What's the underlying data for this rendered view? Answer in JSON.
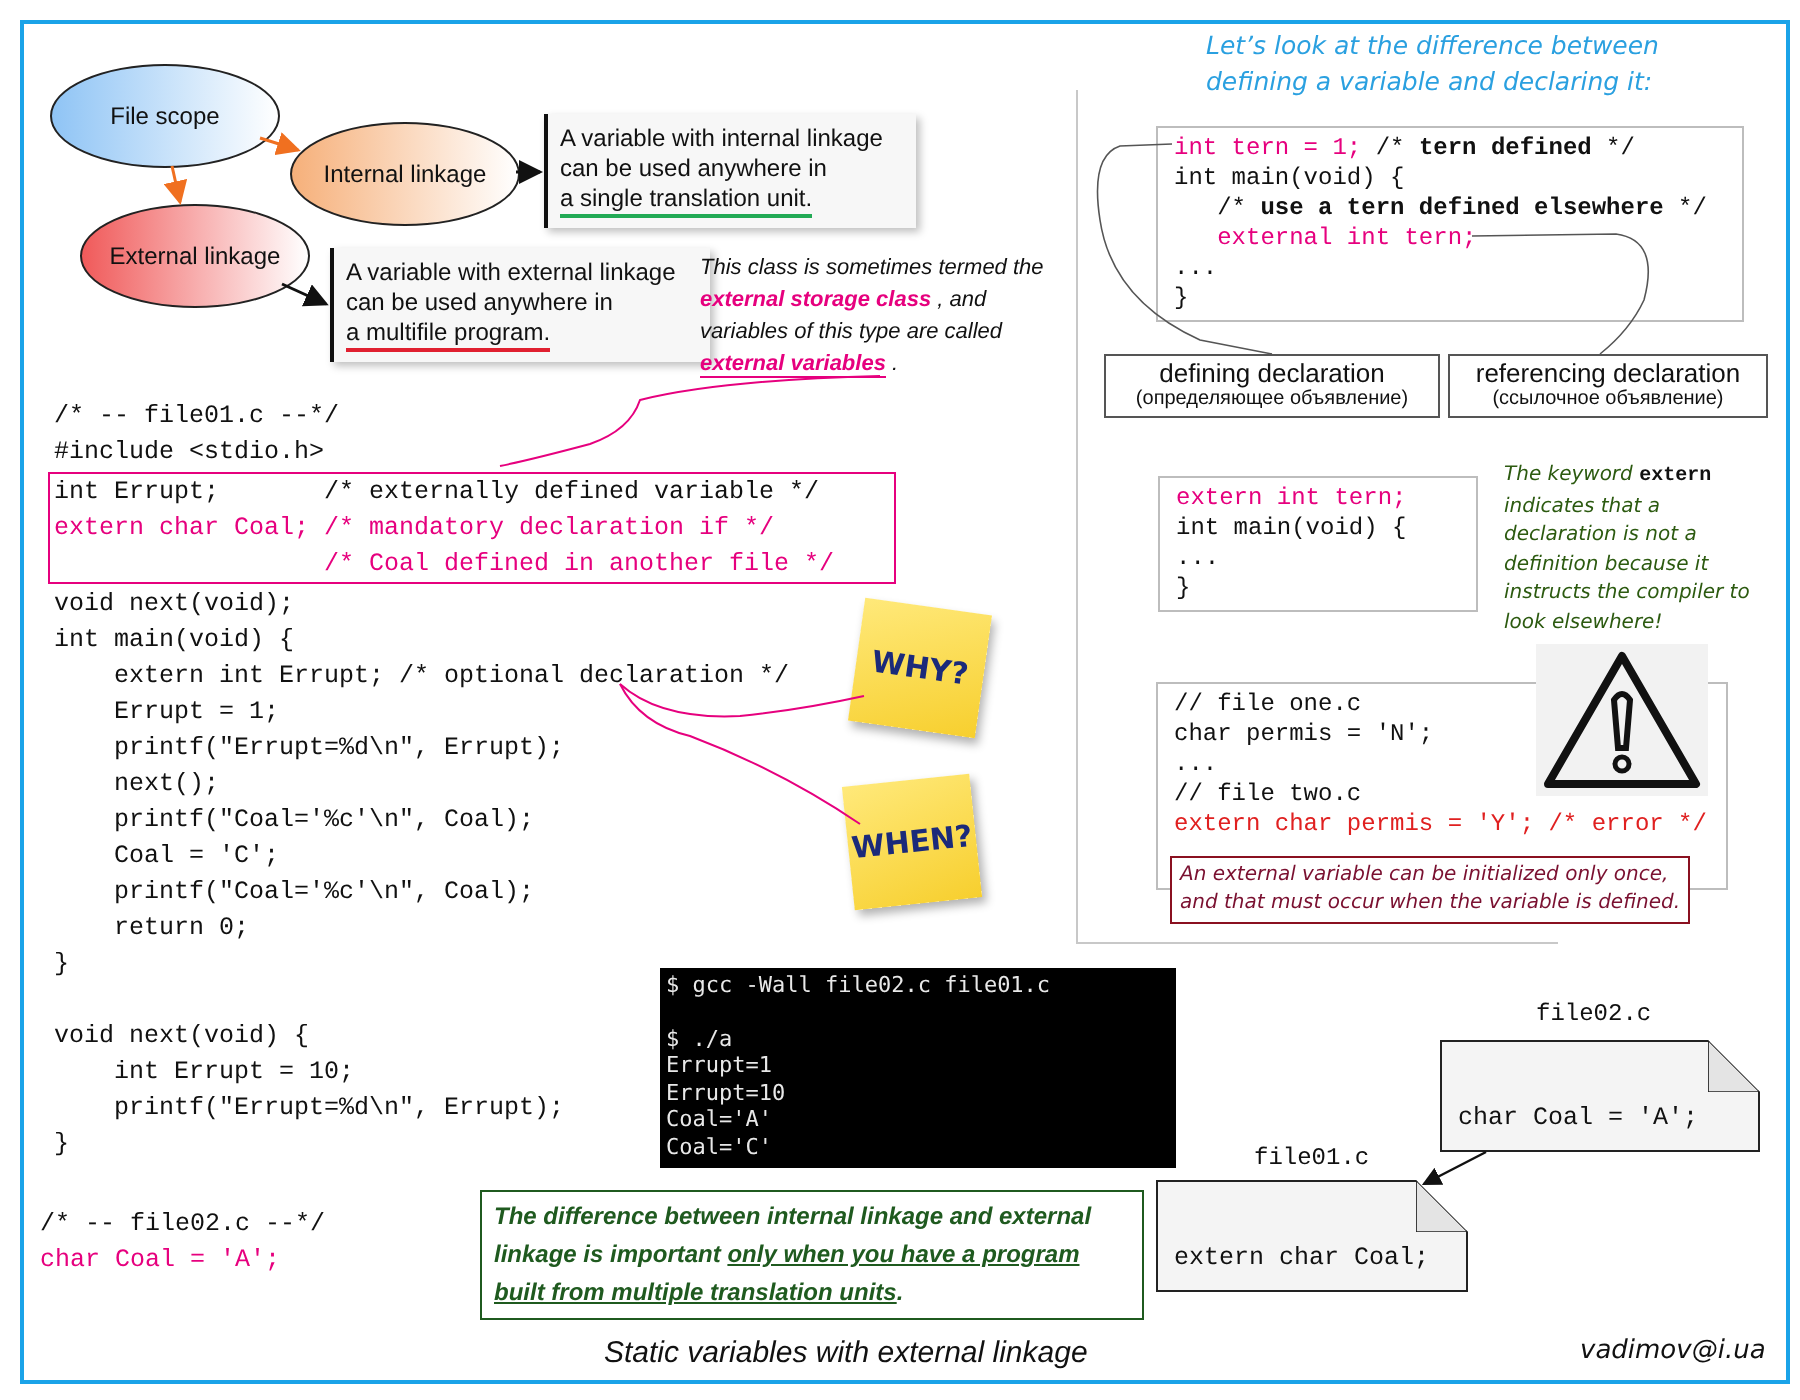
{
  "ellipses": [
    {
      "label": "File scope",
      "color": "#8fc4f5"
    },
    {
      "label": "Internal linkage",
      "color": "#f6b07a"
    },
    {
      "label": "External linkage",
      "color": "#f05a5a"
    }
  ],
  "notes": [
    {
      "lines": [
        "A variable with internal linkage",
        "can be used anywhere in",
        "a single translation unit."
      ],
      "color": "#22aa55"
    },
    {
      "lines": [
        "A variable with external linkage",
        "can be used anywhere in",
        "a multifile program."
      ],
      "color": "#e02030"
    }
  ],
  "side_note": "This class is sometimes termed the **external storage class** , and variables of this type are called **external variables** .",
  "file01_code": [
    {
      "boxed": false,
      "lines": [
        {
          "text": "/* -- file01.c --*/",
          "kind": "plain"
        },
        {
          "text": "#include <stdio.h>",
          "kind": "plain"
        }
      ]
    },
    {
      "boxed": true,
      "lines": [
        {
          "text": "int Errupt;       /* externally defined variable */",
          "kind": "plain"
        },
        {
          "text": "extern char Coal; /* mandatory declaration if */",
          "kind": "pink"
        },
        {
          "text": "                  /* Coal defined in another file */",
          "kind": "pink"
        }
      ]
    },
    {
      "boxed": false,
      "lines": [
        {
          "text": "void next(void);",
          "kind": "plain"
        },
        {
          "text": "int main(void) {",
          "kind": "plain"
        },
        {
          "text": "    extern int Errupt; /* optional declaration */",
          "kind": "plain"
        },
        {
          "text": "    Errupt = 1;",
          "kind": "plain"
        },
        {
          "text": "    printf(\"Errupt=%d\\n\", Errupt);",
          "kind": "plain"
        },
        {
          "text": "    next();",
          "kind": "plain"
        },
        {
          "text": "    printf(\"Coal='%c'\\n\", Coal);",
          "kind": "plain"
        },
        {
          "text": "    Coal = 'C';",
          "kind": "plain"
        },
        {
          "text": "    printf(\"Coal='%c'\\n\", Coal);",
          "kind": "plain"
        },
        {
          "text": "    return 0;",
          "kind": "plain"
        },
        {
          "text": "}",
          "kind": "plain"
        },
        {
          "text": "void next(void) {",
          "kind": "plain",
          "gap_before": true
        },
        {
          "text": "    int Errupt = 10;",
          "kind": "plain"
        },
        {
          "text": "    printf(\"Errupt=%d\\n\", Errupt);",
          "kind": "plain"
        },
        {
          "text": "}",
          "kind": "plain"
        }
      ]
    }
  ],
  "stickers": [
    {
      "label": "WHY?"
    },
    {
      "label": "WHEN?"
    }
  ],
  "terminal": [
    "$ gcc -Wall file02.c file01.c",
    "$ ./a",
    "Errupt=1",
    "Errupt=10",
    "Coal='A'",
    "Coal='C'"
  ],
  "file02_code": [
    {
      "text": "/* -- file02.c --*/",
      "kind": "plain"
    },
    {
      "text": "char Coal = 'A';",
      "kind": "pink"
    }
  ],
  "conclusion": [
    {
      "text": "The difference between internal linkage and external linkage is important ",
      "underlined": false
    },
    {
      "text": "only when you have a program built from multiple translation units",
      "underlined": true
    },
    {
      "text": ".",
      "underlined": false
    }
  ],
  "caption": "Static variables with external linkage",
  "author": "vadimov@i.ua",
  "right_panel": {
    "heading": [
      "Let’s look at the difference between",
      "defining a variable and declaring it:"
    ],
    "code_1": [
      [
        {
          "text": "int tern = 1; ",
          "kind": "pink"
        },
        {
          "text": "/* ",
          "kind": "plain"
        },
        {
          "text": "tern defined",
          "kind": "bold"
        },
        {
          "text": " */",
          "kind": "plain"
        }
      ],
      [
        {
          "text": "int main(void) {",
          "kind": "plain"
        }
      ],
      [
        {
          "text": "   /* ",
          "kind": "plain"
        },
        {
          "text": "use a tern defined elsewhere",
          "kind": "bold"
        },
        {
          "text": " */",
          "kind": "plain"
        }
      ],
      [
        {
          "text": "   external int tern;",
          "kind": "pink"
        }
      ],
      [
        {
          "text": "...",
          "kind": "plain"
        }
      ],
      [
        {
          "text": "}",
          "kind": "plain"
        }
      ]
    ],
    "labels": [
      {
        "title": "defining declaration",
        "subtitle": "(определяющее объявление)"
      },
      {
        "title": "referencing declaration",
        "subtitle": "(ссылочное объявление)"
      }
    ],
    "code_2": [
      [
        {
          "text": "extern int tern;",
          "kind": "pink"
        }
      ],
      [
        {
          "text": "int main(void) {",
          "kind": "plain"
        }
      ],
      [
        {
          "text": "...",
          "kind": "plain"
        }
      ],
      [
        {
          "text": "}",
          "kind": "plain"
        }
      ]
    ],
    "keyword_note": "The keyword **extern** indicates that a declaration is not a definition because it instructs the  compiler to look elsewhere!",
    "code_3": [
      [
        {
          "text": "// file one.c",
          "kind": "plain"
        }
      ],
      [
        {
          "text": "char permis = 'N';",
          "kind": "plain"
        }
      ],
      [
        {
          "text": "...",
          "kind": "plain"
        }
      ],
      [
        {
          "text": "// file two.c",
          "kind": "plain"
        }
      ],
      [
        {
          "text": "extern char permis = 'Y'; /* error */",
          "kind": "error"
        }
      ]
    ],
    "error_note": [
      "An external variable can be initialized only once,",
      "and that must occur when the variable is defined."
    ]
  },
  "file_cards": [
    {
      "filename": "file02.c",
      "code": "char Coal = 'A';"
    },
    {
      "filename": "file01.c",
      "code": "extern char Coal;"
    }
  ]
}
